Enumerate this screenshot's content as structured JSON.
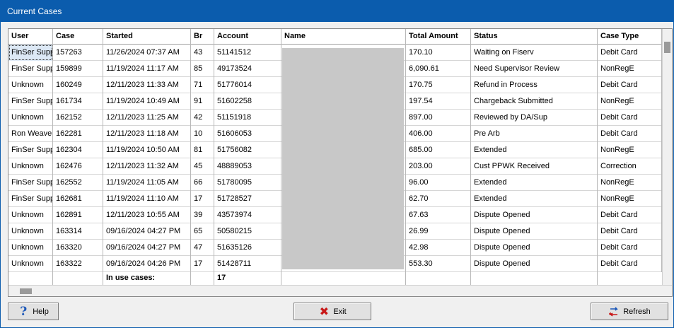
{
  "window": {
    "title": "Current Cases"
  },
  "columns": [
    "User",
    "Case",
    "Started",
    "Br",
    "Account",
    "Name",
    "Total Amount",
    "Status",
    "Case Type"
  ],
  "rows": [
    [
      "FinSer Suppo",
      "157263",
      "11/26/2024 07:37 AM",
      "43",
      "51141512",
      "",
      "170.10",
      "Waiting on Fiserv",
      "Debit Card"
    ],
    [
      "FinSer Suppo",
      "159899",
      "11/19/2024 11:17 AM",
      "85",
      "49173524",
      "",
      "6,090.61",
      "Need Supervisor Review",
      "NonRegE"
    ],
    [
      "Unknown",
      "160249",
      "12/11/2023 11:33 AM",
      "71",
      "51776014",
      "",
      "170.75",
      "Refund in Process",
      "Debit Card"
    ],
    [
      "FinSer Suppo",
      "161734",
      "11/19/2024 10:49 AM",
      "91",
      "51602258",
      "",
      "197.54",
      "Chargeback Submitted",
      "NonRegE"
    ],
    [
      "Unknown",
      "162152",
      "12/11/2023 11:25 AM",
      "42",
      "51151918",
      "",
      "897.00",
      "Reviewed by DA/Sup",
      "Debit Card"
    ],
    [
      "Ron Weaver",
      "162281",
      "12/11/2023 11:18 AM",
      "10",
      "51606053",
      "",
      "406.00",
      "Pre Arb",
      "Debit Card"
    ],
    [
      "FinSer Suppo",
      "162304",
      "11/19/2024 10:50 AM",
      "81",
      "51756082",
      "",
      "685.00",
      "Extended",
      "NonRegE"
    ],
    [
      "Unknown",
      "162476",
      "12/11/2023 11:32 AM",
      "45",
      "48889053",
      "",
      "203.00",
      "Cust PPWK Received",
      "Correction"
    ],
    [
      "FinSer Suppo",
      "162552",
      "11/19/2024 11:05 AM",
      "66",
      "51780095",
      "",
      "96.00",
      "Extended",
      "NonRegE"
    ],
    [
      "FinSer Suppo",
      "162681",
      "11/19/2024 11:10 AM",
      "17",
      "51728527",
      "",
      "62.70",
      "Extended",
      "NonRegE"
    ],
    [
      "Unknown",
      "162891",
      "12/11/2023 10:55 AM",
      "39",
      "43573974",
      "",
      "67.63",
      "Dispute Opened",
      "Debit Card"
    ],
    [
      "Unknown",
      "163314",
      "09/16/2024 04:27 PM",
      "65",
      "50580215",
      "",
      "26.99",
      "Dispute Opened",
      "Debit Card"
    ],
    [
      "Unknown",
      "163320",
      "09/16/2024 04:27 PM",
      "47",
      "51635126",
      "",
      "42.98",
      "Dispute Opened",
      "Debit Card"
    ],
    [
      "Unknown",
      "163322",
      "09/16/2024 04:26 PM",
      "17",
      "51428711",
      "",
      "553.30",
      "Dispute Opened",
      "Debit Card"
    ]
  ],
  "footer": {
    "label": "In use cases:",
    "count": "17"
  },
  "buttons": {
    "help": {
      "label": "Help",
      "icon": "help-icon"
    },
    "exit": {
      "label": "Exit",
      "icon": "exit-x-icon"
    },
    "refresh": {
      "label": "Refresh",
      "icon": "refresh-icon"
    }
  }
}
